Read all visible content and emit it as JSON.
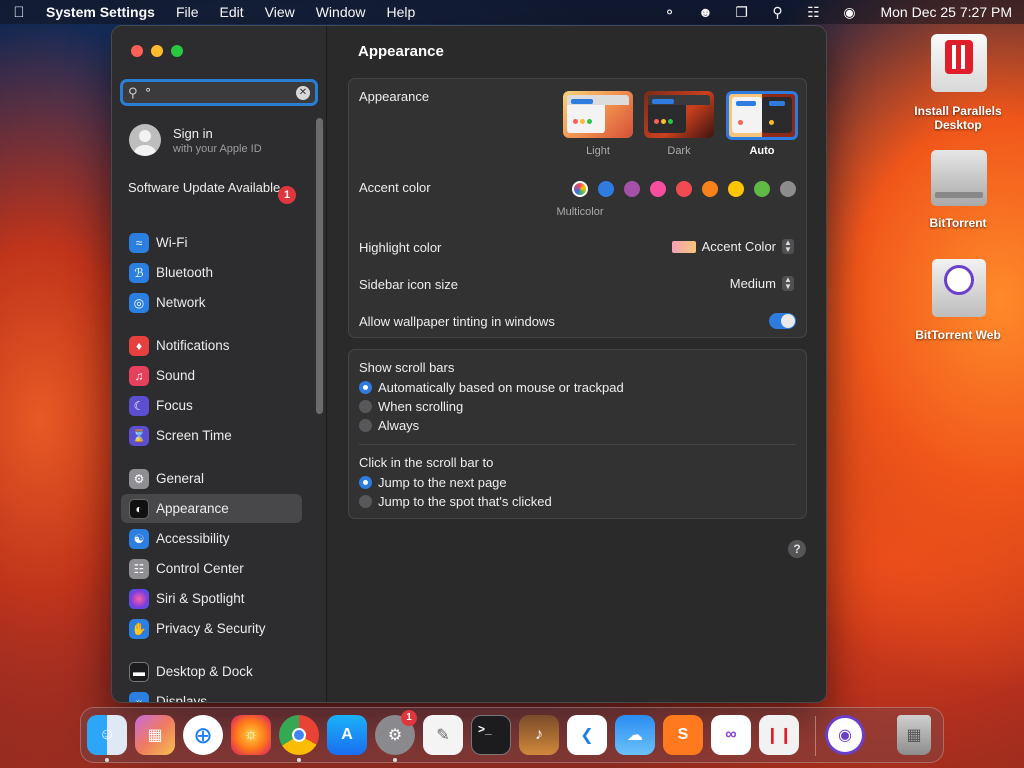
{
  "menubar": {
    "app_name": "System Settings",
    "menus": [
      "File",
      "Edit",
      "View",
      "Window",
      "Help"
    ],
    "clock": "Mon Dec 25  7:27 PM"
  },
  "sidebar": {
    "search": {
      "value": "°"
    },
    "signin": {
      "title": "Sign in",
      "subtitle": "with your Apple ID"
    },
    "software_update": {
      "label": "Software Update Available",
      "badge": "1"
    },
    "items": [
      {
        "label": "Wi-Fi",
        "icon": "wifi-icon",
        "color": "#2a7fe0"
      },
      {
        "label": "Bluetooth",
        "icon": "bluetooth-icon",
        "color": "#2a7fe0"
      },
      {
        "label": "Network",
        "icon": "globe-icon",
        "color": "#2a7fe0"
      },
      {
        "label": "Notifications",
        "icon": "bell-icon",
        "color": "#e6403f"
      },
      {
        "label": "Sound",
        "icon": "speaker-icon",
        "color": "#e6405d"
      },
      {
        "label": "Focus",
        "icon": "moon-icon",
        "color": "#5b4ed1"
      },
      {
        "label": "Screen Time",
        "icon": "hourglass-icon",
        "color": "#5b4ed1"
      },
      {
        "label": "General",
        "icon": "gear-icon",
        "color": "#8e8e93"
      },
      {
        "label": "Appearance",
        "icon": "appearance-icon",
        "color": "#111111"
      },
      {
        "label": "Accessibility",
        "icon": "accessibility-icon",
        "color": "#2a7fe0"
      },
      {
        "label": "Control Center",
        "icon": "control-center-icon",
        "color": "#8e8e93"
      },
      {
        "label": "Siri & Spotlight",
        "icon": "siri-icon",
        "color": "#b03cd6"
      },
      {
        "label": "Privacy & Security",
        "icon": "hand-icon",
        "color": "#2a7fe0"
      },
      {
        "label": "Desktop & Dock",
        "icon": "dock-icon",
        "color": "#1c1c1e"
      },
      {
        "label": "Displays",
        "icon": "display-icon",
        "color": "#2a7fe0"
      }
    ],
    "selected": "Appearance"
  },
  "main": {
    "title": "Appearance",
    "appearance": {
      "label": "Appearance",
      "options": [
        "Light",
        "Dark",
        "Auto"
      ],
      "selected": "Auto"
    },
    "accent": {
      "label": "Accent color",
      "selected_label": "Multicolor",
      "colors": [
        "#2f7ce0",
        "#a550a7",
        "#f74f9e",
        "#f14b52",
        "#f7821b",
        "#ffc600",
        "#62ba46",
        "#8c8c8c"
      ]
    },
    "highlight": {
      "label": "Highlight color",
      "value": "Accent Color"
    },
    "sidebar_icon_size": {
      "label": "Sidebar icon size",
      "value": "Medium"
    },
    "wallpaper_tinting": {
      "label": "Allow wallpaper tinting in windows",
      "enabled": true
    },
    "scroll_bars": {
      "label": "Show scroll bars",
      "options": [
        "Automatically based on mouse or trackpad",
        "When scrolling",
        "Always"
      ],
      "selected": "Automatically based on mouse or trackpad"
    },
    "click_scroll": {
      "label": "Click in the scroll bar to",
      "options": [
        "Jump to the next page",
        "Jump to the spot that's clicked"
      ],
      "selected": "Jump to the next page"
    },
    "help": "?"
  },
  "desktop": {
    "icons": [
      "Install Parallels Desktop",
      "BitTorrent",
      "BitTorrent Web"
    ]
  },
  "dock": {
    "apps": [
      "Finder",
      "Launchpad",
      "Safari",
      "Firefox",
      "Chrome",
      "App Store",
      "System Settings",
      "TextEdit",
      "Terminal",
      "GarageBand",
      "Visual Studio Code",
      "Weather",
      "Sublime Text",
      "Visual Studio",
      "Parallels",
      "BitTorrent Web",
      "Trash"
    ],
    "settings_badge": "1"
  }
}
